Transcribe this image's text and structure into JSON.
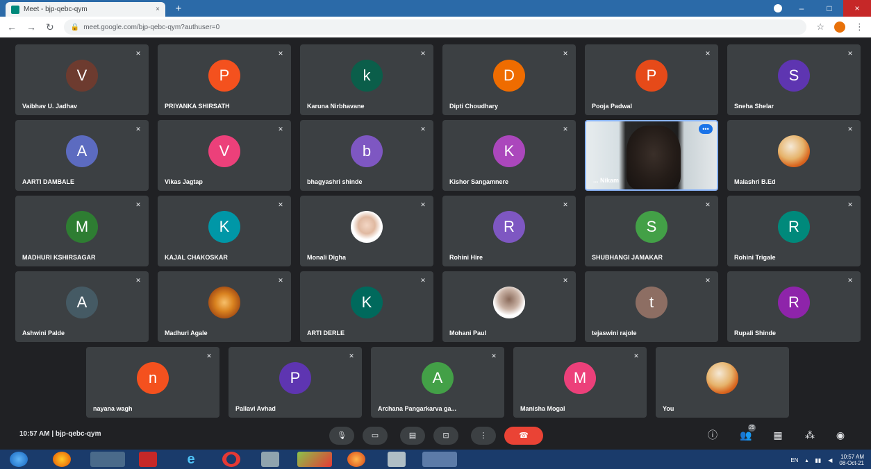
{
  "browser": {
    "tab_title": "Meet - bjp-qebc-qym",
    "tab_close": "×",
    "new_tab": "+",
    "url": "meet.google.com/bjp-qebc-qym?authuser=0",
    "window_controls": {
      "minimize": "–",
      "maximize": "□",
      "close": "×"
    }
  },
  "tiles": [
    {
      "name": "Vaibhav U. Jadhav",
      "initial": "V",
      "color": "#6d3b2f"
    },
    {
      "name": "PRIYANKA SHIRSATH",
      "initial": "P",
      "color": "#f4511e"
    },
    {
      "name": "Karuna Nirbhavane",
      "initial": "k",
      "color": "#0b5e4a"
    },
    {
      "name": "Dipti Choudhary",
      "initial": "D",
      "color": "#ef6c00"
    },
    {
      "name": "Pooja Padwal",
      "initial": "P",
      "color": "#e64a19"
    },
    {
      "name": "Sneha Shelar",
      "initial": "S",
      "color": "#5e35b1"
    },
    {
      "name": "AARTI DAMBALE",
      "initial": "A",
      "color": "#5c6bc0"
    },
    {
      "name": "Vikas Jagtap",
      "initial": "V",
      "color": "#ec407a"
    },
    {
      "name": "bhagyashri shinde",
      "initial": "b",
      "color": "#7e57c2"
    },
    {
      "name": "Kishor Sangamnere",
      "initial": "K",
      "color": "#ab47bc"
    },
    {
      "name": "... Nikam",
      "initial": "",
      "color": "",
      "video": true
    },
    {
      "name": "Malashri B.Ed",
      "initial": "",
      "color": "",
      "photo": "photo"
    },
    {
      "name": "MADHURI KSHIRSAGAR",
      "initial": "M",
      "color": "#2e7d32"
    },
    {
      "name": "KAJAL CHAKOSKAR",
      "initial": "K",
      "color": "#0097a7"
    },
    {
      "name": "Monali Digha",
      "initial": "",
      "color": "",
      "photo": "photo-face"
    },
    {
      "name": "Rohini Hire",
      "initial": "R",
      "color": "#7e57c2"
    },
    {
      "name": "SHUBHANGI JAMAKAR",
      "initial": "S",
      "color": "#43a047"
    },
    {
      "name": "Rohini Trigale",
      "initial": "R",
      "color": "#00897b"
    },
    {
      "name": "Ashwini Palde",
      "initial": "A",
      "color": "#455a64"
    },
    {
      "name": "Madhuri Agale",
      "initial": "",
      "color": "",
      "photo": "photo-flower"
    },
    {
      "name": "ARTI DERLE",
      "initial": "K",
      "color": "#00695c"
    },
    {
      "name": "Mohani Paul",
      "initial": "",
      "color": "",
      "photo": "photo-person"
    },
    {
      "name": "tejaswini rajole",
      "initial": "t",
      "color": "#8d6e63"
    },
    {
      "name": "Rupali Shinde",
      "initial": "R",
      "color": "#8e24aa"
    },
    {
      "name": "nayana wagh",
      "initial": "n",
      "color": "#f4511e"
    },
    {
      "name": "Pallavi Avhad",
      "initial": "P",
      "color": "#5e35b1"
    },
    {
      "name": "Archana Pangarkarva ga...",
      "initial": "A",
      "color": "#43a047"
    },
    {
      "name": "Manisha Mogal",
      "initial": "M",
      "color": "#ec407a"
    },
    {
      "name": "You",
      "initial": "",
      "color": "",
      "photo": "photo",
      "self": true
    }
  ],
  "bottombar": {
    "time": "10:57 AM",
    "separator": "|",
    "meeting_code": "bjp-qebc-qym",
    "participant_count": "29"
  },
  "taskbar": {
    "clock_time": "10:57 AM",
    "clock_date": "08-Oct-21",
    "lang": "EN"
  }
}
